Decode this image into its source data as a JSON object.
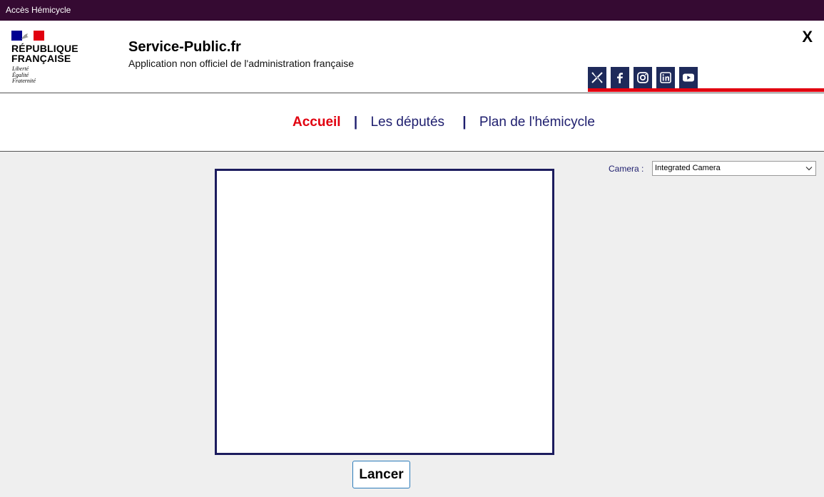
{
  "window": {
    "title": "Accès Hémicycle"
  },
  "header": {
    "logo": {
      "name": "RÉPUBLIQUE\nFRANÇAISE",
      "motto": "Liberté\nÉgalité\nFraternité",
      "flag_colors": [
        "#000091",
        "#ffffff",
        "#e1000f"
      ]
    },
    "site_title": "Service-Public.fr",
    "site_subtitle": "Application non officiel de l'administration française",
    "close_label": "X",
    "social": [
      {
        "icon": "x-icon"
      },
      {
        "icon": "facebook-icon"
      },
      {
        "icon": "instagram-icon"
      },
      {
        "icon": "linkedin-icon"
      },
      {
        "icon": "youtube-icon"
      }
    ]
  },
  "nav": {
    "items": [
      {
        "label": "Accueil",
        "active": true
      },
      {
        "label": "Les députés",
        "active": false
      },
      {
        "label": "Plan de l'hémicycle",
        "active": false
      }
    ],
    "separator": "|"
  },
  "main": {
    "launch_label": "Lancer",
    "camera": {
      "label": "Camera :",
      "selected": "Integrated Camera"
    }
  },
  "colors": {
    "titlebar": "#350a32",
    "accent_red": "#e1000f",
    "navy": "#1e1e6e",
    "social_bg": "#1e2a5a"
  }
}
